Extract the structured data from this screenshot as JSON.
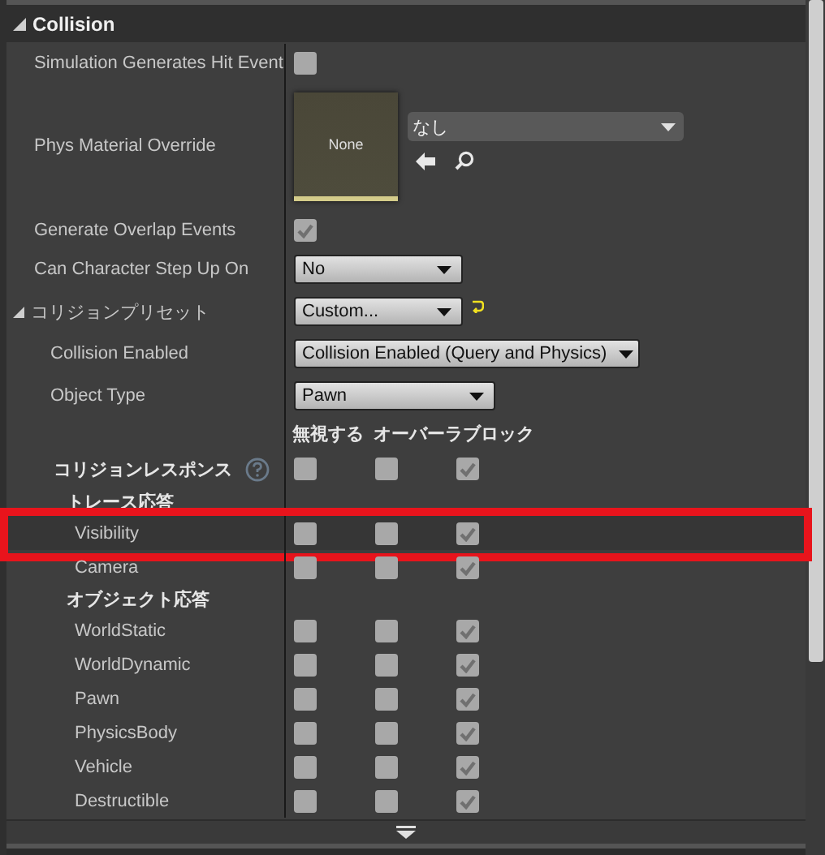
{
  "section": {
    "title": "Collision",
    "expanded": true
  },
  "rows": [
    {
      "kind": "checkbox",
      "label": "Simulation Generates Hit Event",
      "checked": false
    },
    {
      "kind": "asset",
      "label": "Phys Material Override",
      "thumbnail": "None",
      "value": "なし"
    },
    {
      "kind": "checkbox",
      "label": "Generate Overlap Events",
      "checked": true
    },
    {
      "kind": "dropdown",
      "label": "Can Character Step Up On",
      "value": "No",
      "indent": false
    },
    {
      "kind": "preset",
      "label": "コリジョンプリセット",
      "value": "Custom...",
      "expanded": true
    },
    {
      "kind": "dropdown",
      "label": "Collision Enabled",
      "value": "Collision Enabled (Query and Physics)",
      "indent": true
    },
    {
      "kind": "dropdown",
      "label": "Object Type",
      "value": "Pawn",
      "indent": true
    }
  ],
  "response_columns": [
    "無視する",
    "オーバーラ",
    "ブロック"
  ],
  "responses": {
    "label": "コリジョンレスポンス",
    "checks": [
      false,
      false,
      true
    ]
  },
  "groups": [
    {
      "title": "トレース応答",
      "items": [
        {
          "label": "Visibility",
          "checks": [
            false,
            false,
            true
          ],
          "highlighted": true
        },
        {
          "label": "Camera",
          "checks": [
            false,
            false,
            true
          ],
          "highlighted": false
        }
      ]
    },
    {
      "title": "オブジェクト応答",
      "items": [
        {
          "label": "WorldStatic",
          "checks": [
            false,
            false,
            true
          ],
          "highlighted": false
        },
        {
          "label": "WorldDynamic",
          "checks": [
            false,
            false,
            true
          ],
          "highlighted": false
        },
        {
          "label": "Pawn",
          "checks": [
            false,
            false,
            true
          ],
          "highlighted": false
        },
        {
          "label": "PhysicsBody",
          "checks": [
            false,
            false,
            true
          ],
          "highlighted": false
        },
        {
          "label": "Vehicle",
          "checks": [
            false,
            false,
            true
          ],
          "highlighted": false
        },
        {
          "label": "Destructible",
          "checks": [
            false,
            false,
            true
          ],
          "highlighted": false
        }
      ]
    }
  ]
}
